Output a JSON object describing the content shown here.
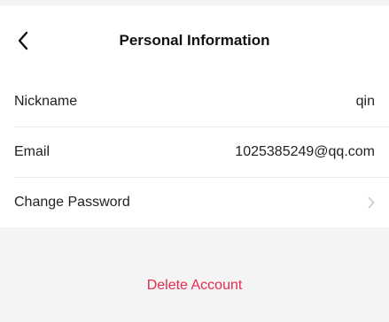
{
  "header": {
    "title": "Personal Information",
    "back_icon": "chevron-left-icon"
  },
  "info": {
    "rows": [
      {
        "label": "Nickname",
        "value": "qin"
      },
      {
        "label": "Email",
        "value": "1025385249@qq.com"
      },
      {
        "label": "Change Password",
        "value": "",
        "icon": "chevron-right-icon"
      }
    ]
  },
  "actions": {
    "delete_label": "Delete Account",
    "delete_color": "#e8294f"
  }
}
